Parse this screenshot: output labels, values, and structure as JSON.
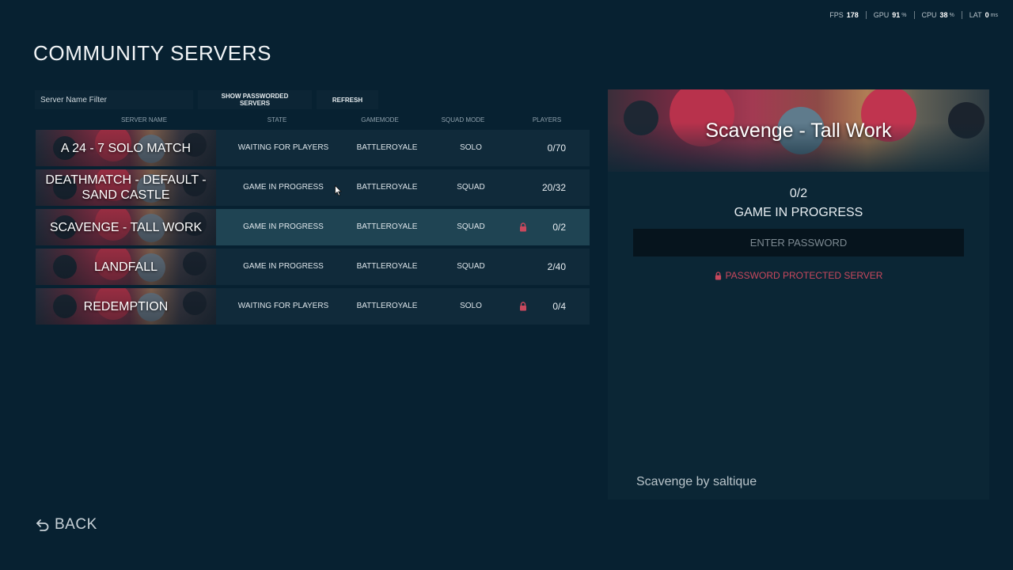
{
  "perf": {
    "fps_label": "FPS",
    "fps_value": "178",
    "gpu_label": "GPU",
    "gpu_value": "91",
    "gpu_unit": "%",
    "cpu_label": "CPU",
    "cpu_value": "38",
    "cpu_unit": "%",
    "lat_label": "LAT",
    "lat_value": "0",
    "lat_unit": "ms"
  },
  "title": "COMMUNITY SERVERS",
  "toolbar": {
    "filter_placeholder": "Server Name Filter",
    "show_passworded_label": "SHOW PASSWORDED SERVERS",
    "refresh_label": "REFRESH"
  },
  "columns": {
    "server_name": "SERVER NAME",
    "state": "STATE",
    "gamemode": "GAMEMODE",
    "squad_mode": "SQUAD MODE",
    "players": "PLAYERS"
  },
  "servers": [
    {
      "name": "A 24 - 7 SOLO MATCH",
      "state": "WAITING FOR PLAYERS",
      "gamemode": "BATTLEROYALE",
      "squad_mode": "SOLO",
      "players": "0/70",
      "locked": false,
      "selected": false
    },
    {
      "name": "DEATHMATCH - DEFAULT - SAND CASTLE",
      "state": "GAME IN PROGRESS",
      "gamemode": "BATTLEROYALE",
      "squad_mode": "SQUAD",
      "players": "20/32",
      "locked": false,
      "selected": false
    },
    {
      "name": "SCAVENGE - TALL WORK",
      "state": "GAME IN PROGRESS",
      "gamemode": "BATTLEROYALE",
      "squad_mode": "SQUAD",
      "players": "0/2",
      "locked": true,
      "selected": true
    },
    {
      "name": "LANDFALL",
      "state": "GAME IN PROGRESS",
      "gamemode": "BATTLEROYALE",
      "squad_mode": "SQUAD",
      "players": "2/40",
      "locked": false,
      "selected": false
    },
    {
      "name": "REDEMPTION",
      "state": "WAITING FOR PLAYERS",
      "gamemode": "BATTLEROYALE",
      "squad_mode": "SOLO",
      "players": "0/4",
      "locked": true,
      "selected": false
    }
  ],
  "detail": {
    "title": "Scavenge - Tall Work",
    "players": "0/2",
    "state": "GAME IN PROGRESS",
    "password_placeholder": "ENTER PASSWORD",
    "password_warning": "PASSWORD PROTECTED SERVER",
    "author": "Scavenge by saltique"
  },
  "back_label": "BACK",
  "colors": {
    "background": "#072131",
    "row": "#102a3a",
    "row_selected": "#1f4453",
    "warning": "#c9485d"
  },
  "icons": [
    "lock-icon",
    "back-arrow-icon",
    "mouse-cursor-icon"
  ]
}
